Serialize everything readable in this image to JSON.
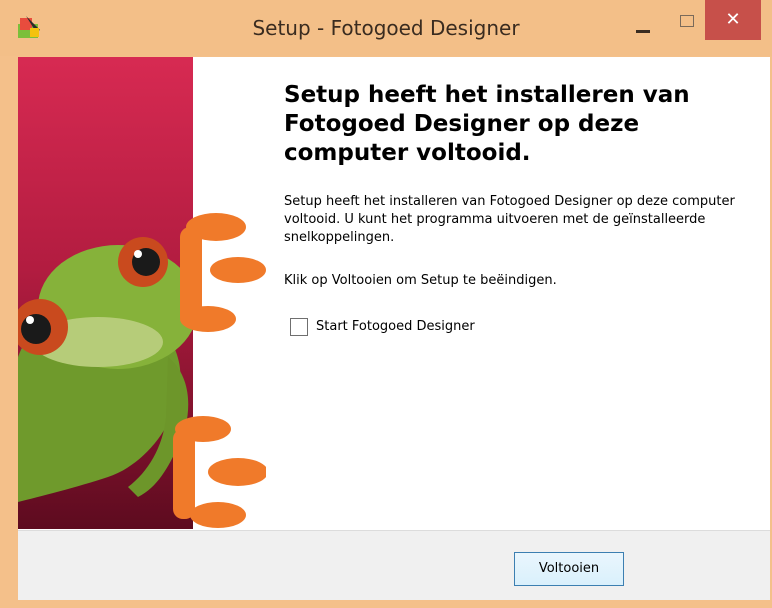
{
  "window": {
    "title": "Setup - Fotogoed Designer",
    "icon": "setup-installer-icon",
    "controls": {
      "minimize": "minimize-icon",
      "maximize": "maximize-icon",
      "close": "✕"
    }
  },
  "banner": {
    "image": "frog-mascot-image"
  },
  "content": {
    "heading": "Setup heeft het installeren van Fotogoed Designer op deze computer voltooid.",
    "description": "Setup heeft het installeren van Fotogoed Designer op deze computer voltooid. U kunt het programma uitvoeren met de geïnstalleerde snelkoppelingen.",
    "instruction": "Klik op Voltooien om Setup te beëindigen.",
    "launch_checkbox": {
      "label": "Start Fotogoed Designer",
      "checked": false
    }
  },
  "footer": {
    "finish_label": "Voltooien"
  },
  "colors": {
    "frame": "#f3bf88",
    "close": "#c7504a",
    "banner_top": "#d72a52",
    "banner_bottom": "#5d0b1f",
    "button_border": "#3c7fb1"
  }
}
